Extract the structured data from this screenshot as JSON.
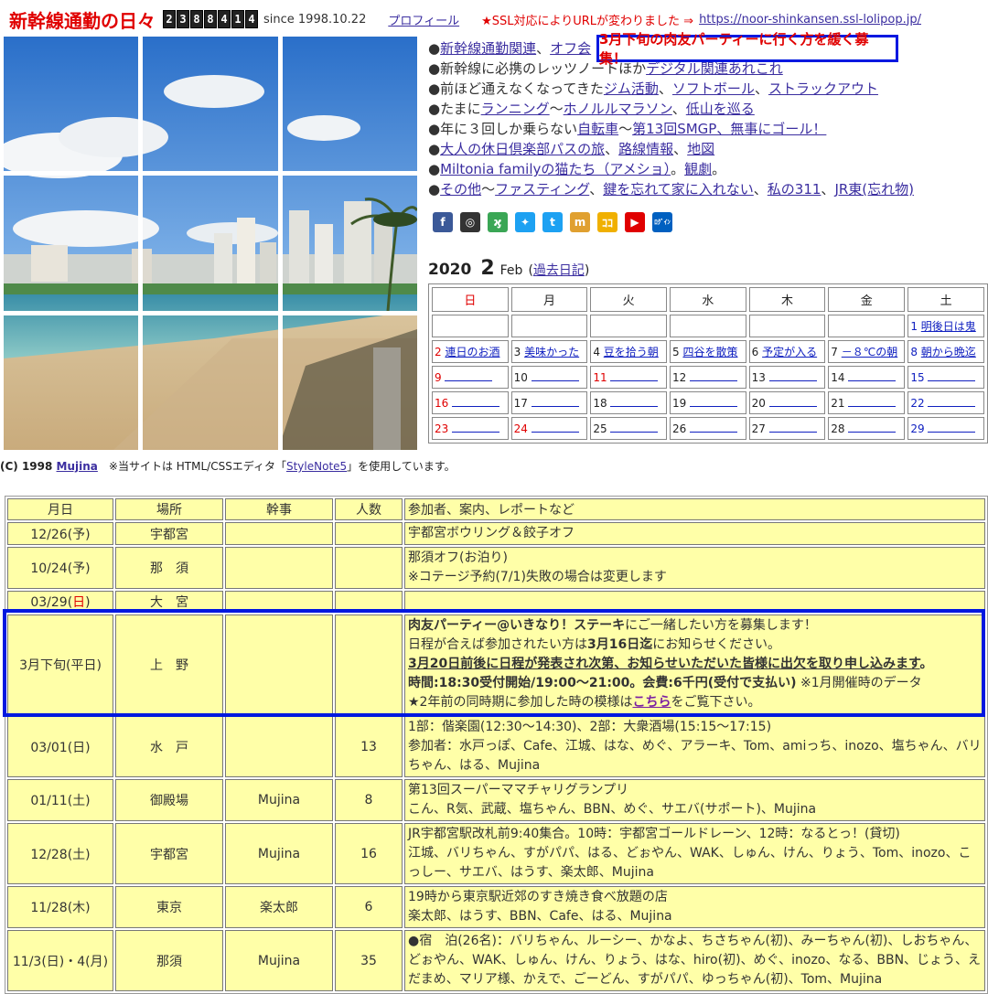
{
  "header": {
    "title": "新幹線通勤の日々",
    "counter_digits": [
      "2",
      "3",
      "8",
      "8",
      "4",
      "1",
      "4"
    ],
    "since": "since 1998.10.22",
    "profile_link": "プロフィール",
    "ssl_notice": "★SSL対応によりURLが変わりました ⇒",
    "ssl_url": "https://noor-shinkansen.ssl-lolipop.jp/"
  },
  "notice": "3月下旬の肉友パーティーに行く方を緩く募集！",
  "nav": [
    {
      "parts": [
        {
          "t": "●",
          "l": false
        },
        {
          "t": "新幹線通勤関連",
          "l": true
        },
        {
          "t": "、",
          "l": false
        },
        {
          "t": "オフ会",
          "l": true
        }
      ]
    },
    {
      "parts": [
        {
          "t": "●新幹線に必携のレッツノートほか",
          "l": false
        },
        {
          "t": "デジタル関連あれこれ",
          "l": true
        }
      ]
    },
    {
      "parts": [
        {
          "t": "●前ほど通えなくなってきた",
          "l": false
        },
        {
          "t": "ジム活動",
          "l": true
        },
        {
          "t": "、",
          "l": false
        },
        {
          "t": "ソフトボール",
          "l": true
        },
        {
          "t": "、",
          "l": false
        },
        {
          "t": "ストラックアウト",
          "l": true
        }
      ]
    },
    {
      "parts": [
        {
          "t": "●たまに",
          "l": false
        },
        {
          "t": "ランニング",
          "l": true
        },
        {
          "t": "〜",
          "l": false
        },
        {
          "t": "ホノルルマラソン",
          "l": true
        },
        {
          "t": "、",
          "l": false
        },
        {
          "t": "低山を巡る",
          "l": true
        }
      ]
    },
    {
      "parts": [
        {
          "t": "●年に３回しか乗らない",
          "l": false
        },
        {
          "t": "自転車",
          "l": true
        },
        {
          "t": "〜",
          "l": false
        },
        {
          "t": "第13回SMGP、無事にゴール！",
          "l": true
        }
      ]
    },
    {
      "parts": [
        {
          "t": "●",
          "l": false
        },
        {
          "t": "大人の休日倶楽部パスの旅",
          "l": true
        },
        {
          "t": "、",
          "l": false
        },
        {
          "t": "路線情報",
          "l": true
        },
        {
          "t": "、",
          "l": false
        },
        {
          "t": "地図",
          "l": true
        }
      ]
    },
    {
      "parts": [
        {
          "t": "●",
          "l": false
        },
        {
          "t": "Miltonia familyの猫たち（アメショ）",
          "l": true
        },
        {
          "t": "。",
          "l": false
        },
        {
          "t": "観劇",
          "l": true
        },
        {
          "t": "。",
          "l": false
        }
      ]
    },
    {
      "parts": [
        {
          "t": "●",
          "l": false
        },
        {
          "t": "その他",
          "l": true
        },
        {
          "t": "〜",
          "l": false
        },
        {
          "t": "ファスティング",
          "l": true
        },
        {
          "t": "、",
          "l": false
        },
        {
          "t": "鍵を忘れて家に入れない",
          "l": true
        },
        {
          "t": "、",
          "l": false
        },
        {
          "t": "私の311",
          "l": true
        },
        {
          "t": "、",
          "l": false
        },
        {
          "t": "JR東(忘れ物)",
          "l": true
        }
      ]
    }
  ],
  "social": [
    {
      "name": "facebook-icon",
      "glyph": "f",
      "color": "#3b5998"
    },
    {
      "name": "instagram-icon",
      "glyph": "◎",
      "color": "#333333"
    },
    {
      "name": "frog-icon",
      "glyph": "ϗ",
      "color": "#3aa655"
    },
    {
      "name": "twitter-icon",
      "glyph": "✦",
      "color": "#1da1f2"
    },
    {
      "name": "tumblr-icon",
      "glyph": "t",
      "color": "#1da1f2"
    },
    {
      "name": "mixi-icon",
      "glyph": "m",
      "color": "#e0a030"
    },
    {
      "name": "coconala-icon",
      "glyph": "ｺｺ",
      "color": "#f0b000"
    },
    {
      "name": "youtube-icon",
      "glyph": "▶",
      "color": "#e00000"
    },
    {
      "name": "login-icon",
      "glyph": "ﾛｸﾞｲﾝ",
      "color": "#0060c0"
    }
  ],
  "calendar": {
    "year": "2020",
    "month_num": "2",
    "month_name": "Feb",
    "past_link": "過去日記",
    "weekdays": [
      "日",
      "月",
      "火",
      "水",
      "木",
      "金",
      "土"
    ],
    "weeks": [
      [
        null,
        null,
        null,
        null,
        null,
        null,
        {
          "d": "1",
          "t": "明後日は鬼",
          "c": "blue"
        }
      ],
      [
        {
          "d": "2",
          "t": "連日のお酒",
          "c": "red"
        },
        {
          "d": "3",
          "t": "美味かった",
          "c": "black"
        },
        {
          "d": "4",
          "t": "豆を拾う朝",
          "c": "black"
        },
        {
          "d": "5",
          "t": "四谷を散策",
          "c": "black"
        },
        {
          "d": "6",
          "t": "予定が入る",
          "c": "black"
        },
        {
          "d": "7",
          "t": "－８℃の朝",
          "c": "black"
        },
        {
          "d": "8",
          "t": "朝から晩迄",
          "c": "blue"
        }
      ],
      [
        {
          "d": "9",
          "t": "",
          "c": "red"
        },
        {
          "d": "10",
          "t": "",
          "c": "black"
        },
        {
          "d": "11",
          "t": "",
          "c": "red"
        },
        {
          "d": "12",
          "t": "",
          "c": "black"
        },
        {
          "d": "13",
          "t": "",
          "c": "black"
        },
        {
          "d": "14",
          "t": "",
          "c": "black"
        },
        {
          "d": "15",
          "t": "",
          "c": "blue"
        }
      ],
      [
        {
          "d": "16",
          "t": "",
          "c": "red"
        },
        {
          "d": "17",
          "t": "",
          "c": "black"
        },
        {
          "d": "18",
          "t": "",
          "c": "black"
        },
        {
          "d": "19",
          "t": "",
          "c": "black"
        },
        {
          "d": "20",
          "t": "",
          "c": "black"
        },
        {
          "d": "21",
          "t": "",
          "c": "black"
        },
        {
          "d": "22",
          "t": "",
          "c": "blue"
        }
      ],
      [
        {
          "d": "23",
          "t": "",
          "c": "red"
        },
        {
          "d": "24",
          "t": "",
          "c": "red"
        },
        {
          "d": "25",
          "t": "",
          "c": "black"
        },
        {
          "d": "26",
          "t": "",
          "c": "black"
        },
        {
          "d": "27",
          "t": "",
          "c": "black"
        },
        {
          "d": "28",
          "t": "",
          "c": "black"
        },
        {
          "d": "29",
          "t": "",
          "c": "blue"
        }
      ]
    ]
  },
  "copyright": {
    "prefix": "(C) 1998 ",
    "author": "Mujina",
    "note": "　※当サイトは HTML/CSSエディタ「",
    "editor": "StyleNote5",
    "suffix": "」を使用しています。"
  },
  "events": {
    "headers": [
      "月日",
      "場所",
      "幹事",
      "人数",
      "参加者、案内、レポートなど"
    ],
    "rows": [
      {
        "date": "12/26(予)",
        "place": "宇都宮",
        "host": "",
        "count": "",
        "info": [
          [
            {
              "t": "宇都宮ボウリング＆餃子オフ"
            }
          ]
        ]
      },
      {
        "date": "10/24(予)",
        "place": "那　須",
        "host": "",
        "count": "",
        "info": [
          [
            {
              "t": "那須オフ(お泊り)"
            }
          ],
          [
            {
              "t": "※コテージ予約(7/1)失敗の場合は変更します"
            }
          ]
        ]
      },
      {
        "date": "03/29(",
        "date_red": "日",
        "date_end": ")",
        "place": "大　宮",
        "host": "",
        "count": "",
        "info": [
          [
            {
              "t": ""
            }
          ]
        ]
      },
      {
        "date": "3月下旬(平日)",
        "place": "上　野",
        "host": "",
        "count": "",
        "info": [
          [
            {
              "t": "肉友パーティー@いきなり！ステーキ",
              "b": true
            },
            {
              "t": "にご一緒したい方を募集します！"
            }
          ],
          [
            {
              "t": "日程が合えば参加されたい方は"
            },
            {
              "t": "3月16日迄",
              "b": true
            },
            {
              "t": "にお知らせください。"
            }
          ],
          [
            {
              "t": "3月20日前後に日程が発表され次第、お知らせいただいた皆様に出欠を取り申し込みます",
              "b": true,
              "u": true
            },
            {
              "t": "。",
              "b": true
            }
          ],
          [
            {
              "t": "時間:18:30受付開始/19:00～21:00。会費:6千円(受付で支払い)",
              "b": true
            },
            {
              "t": " ※1月開催時のデータ"
            }
          ],
          [
            {
              "t": "★2年前の同時期に参加した時の模様は"
            },
            {
              "t": "こちら",
              "b": true,
              "link": true
            },
            {
              "t": "をご覧下さい。"
            }
          ]
        ]
      },
      {
        "date": "03/01(日)",
        "place": "水　戸",
        "host": "",
        "count": "13",
        "info": [
          [
            {
              "t": "1部：偕楽園(12:30～14:30)、2部：大衆酒場(15:15～17:15)"
            }
          ],
          [
            {
              "t": "参加者：水戸っぽ、Cafe、江城、はな、めぐ、アラーキ、Tom、amiっち、inozo、塩ちゃん、バリちゃん、はる、Mujina"
            }
          ]
        ]
      },
      {
        "date": "01/11(土)",
        "place": "御殿場",
        "host": "Mujina",
        "count": "8",
        "info": [
          [
            {
              "t": "第13回スーパーママチャリグランプリ"
            }
          ],
          [
            {
              "t": "こん、R気、武蔵、塩ちゃん、BBN、めぐ、サエバ(サポート)、Mujina"
            }
          ]
        ]
      },
      {
        "date": "12/28(土)",
        "place": "宇都宮",
        "host": "Mujina",
        "count": "16",
        "info": [
          [
            {
              "t": "JR宇都宮駅改札前9:40集合。10時：宇都宮ゴールドレーン、12時：なるとっ！(貸切)"
            }
          ],
          [
            {
              "t": "江城、バリちゃん、すがパパ、はる、どぉやん、WAK、しゅん、けん、りょう、Tom、inozo、こっしー、サエバ、はうす、楽太郎、Mujina"
            }
          ]
        ]
      },
      {
        "date": "11/28(木)",
        "place": "東京",
        "host": "楽太郎",
        "count": "6",
        "info": [
          [
            {
              "t": "19時から東京駅近郊のすき焼き食べ放題の店"
            }
          ],
          [
            {
              "t": "楽太郎、はうす、BBN、Cafe、はる、Mujina"
            }
          ]
        ]
      },
      {
        "date": "11/3(日)・4(月)",
        "place": "那須",
        "host": "Mujina",
        "count": "35",
        "info": [
          [
            {
              "t": "●宿　泊(26名)：バリちゃん、ルーシー、かなよ、ちさちゃん(初)、みーちゃん(初)、しおちゃん、どぉやん、WAK、しゅん、けん、りょう、はな、hiro(初)、めぐ、inozo、なる、BBN、じょう、えだまめ、マリア様、かえで、ごーどん、すがパパ、ゆっちゃん(初)、Tom、Mujina"
            }
          ]
        ]
      }
    ]
  }
}
